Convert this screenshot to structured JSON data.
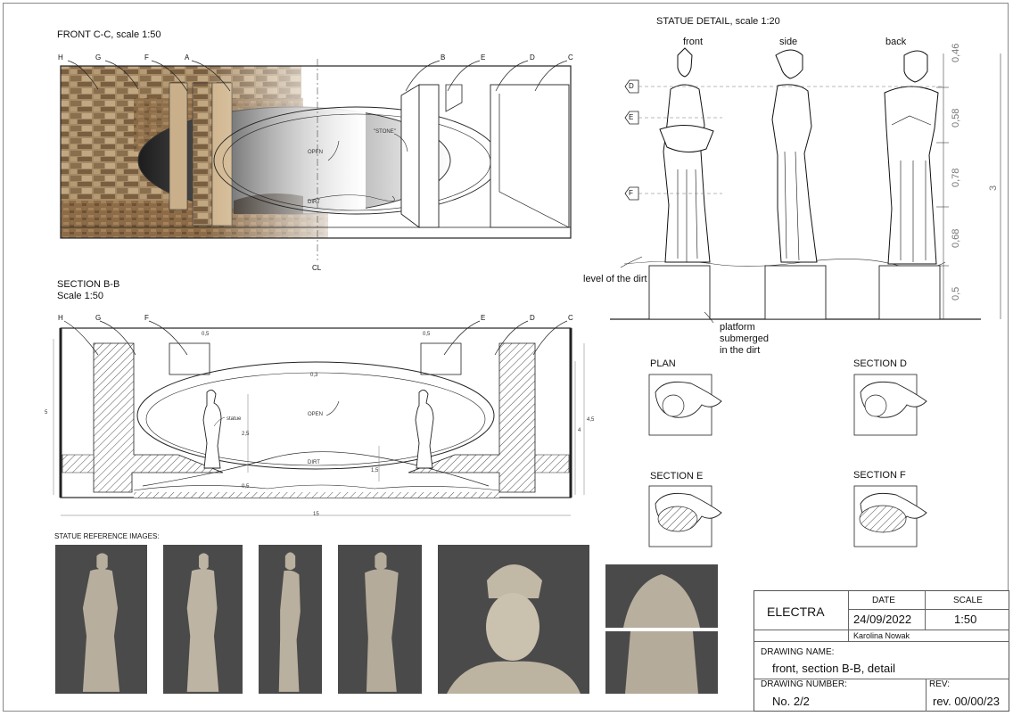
{
  "front_view": {
    "title": "FRONT C-C, scale 1:50",
    "markers": [
      "H",
      "G",
      "F",
      "A",
      "B",
      "E",
      "D",
      "C"
    ],
    "labels": {
      "stone": "\"STONE\"",
      "open": "OPEN",
      "dirt": "DIRT",
      "cl": "CL"
    }
  },
  "section_bb": {
    "title": "SECTION B-B",
    "scale": "Scale 1:50",
    "markers": [
      "H",
      "G",
      "F",
      "E",
      "D",
      "C"
    ],
    "labels": {
      "open": "OPEN",
      "dirt": "DIRT",
      "statue": "statue"
    },
    "dims": {
      "top_left": "0,5",
      "top_right": "0,5",
      "ring": "0,3",
      "left_h": "5",
      "right_h_a": "4,5",
      "right_h_b": "4",
      "statue_h": "2,5",
      "base_h": "0,5",
      "dirt_h": "1,5",
      "width": "15"
    }
  },
  "statue_detail": {
    "title": "STATUE DETAIL, scale 1:20",
    "views": [
      "front",
      "side",
      "back"
    ],
    "section_markers": [
      "D",
      "E",
      "F"
    ],
    "dims": [
      "0,46",
      "0,58",
      "0,78",
      "0,68",
      "0,5"
    ],
    "total": "3",
    "dirt_label": "level of the dirt",
    "platform_label_1": "platform",
    "platform_label_2": "submerged",
    "platform_label_3": "in the dirt"
  },
  "sections": {
    "plan": "PLAN",
    "section_d": "SECTION D",
    "section_e": "SECTION E",
    "section_f": "SECTION F"
  },
  "references": {
    "title": "STATUE REFERENCE IMAGES:"
  },
  "title_block": {
    "project": "ELECTRA",
    "date_label": "DATE",
    "date": "24/09/2022",
    "scale_label": "SCALE",
    "scale": "1:50",
    "author": "Karolina Nowak",
    "drawing_name_label": "DRAWING NAME:",
    "drawing_name": "front, section B-B, detail",
    "drawing_number_label": "DRAWING NUMBER:",
    "drawing_number": "No. 2/2",
    "rev_label": "REV:",
    "rev": "rev. 00/00/23"
  }
}
